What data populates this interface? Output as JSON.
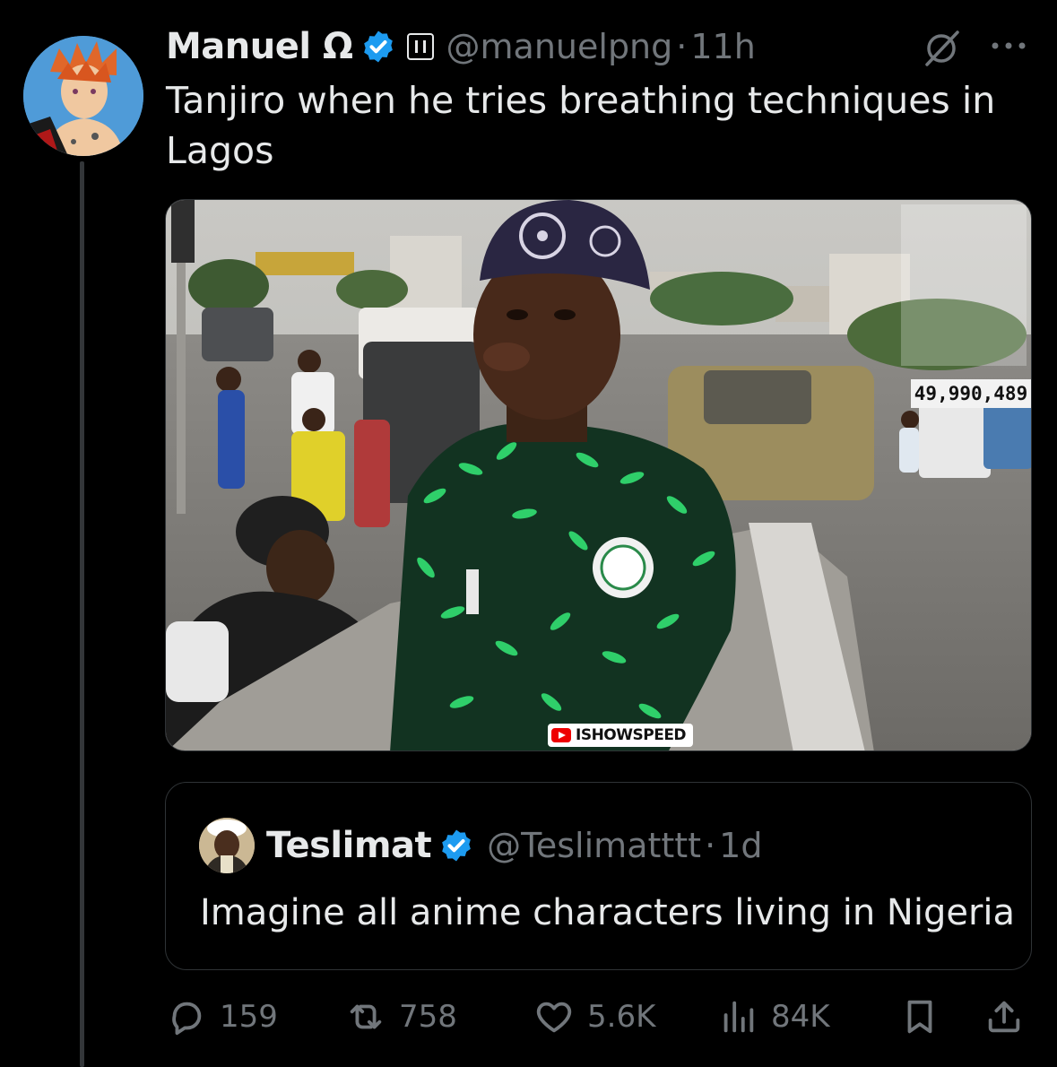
{
  "tweet": {
    "author": {
      "display_name": "Manuel Ω",
      "handle": "@manuelpng",
      "separator": "·",
      "time": "11h",
      "verified": true,
      "avatar_icon": "anime-avatar"
    },
    "text": "Tanjiro when he tries breathing techniques in Lagos",
    "media": {
      "viewer_count": "49,990,489",
      "watermark": "ISHOWSPEED"
    },
    "quote": {
      "display_name": "Teslimat",
      "handle": "@Teslimatttt",
      "separator": "·",
      "time": "1d",
      "verified": true,
      "text": "Imagine all anime characters living in Nigeria"
    },
    "actions": {
      "replies": "159",
      "reposts": "758",
      "likes": "5.6K",
      "views": "84K"
    }
  },
  "colors": {
    "background": "#000000",
    "primary_text": "#e7e9ea",
    "secondary_text": "#71767b",
    "verified_blue": "#1d9bf0",
    "border": "#2f3336"
  }
}
